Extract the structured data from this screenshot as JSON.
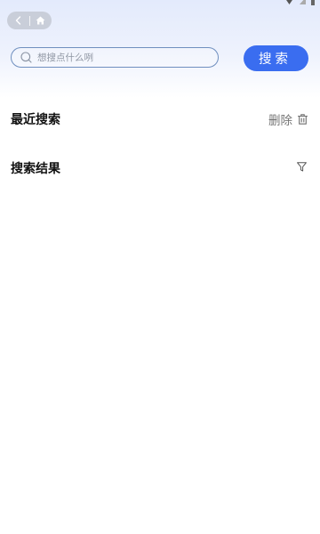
{
  "header": {
    "back_icon": "chevron-left-icon",
    "home_icon": "home-icon"
  },
  "search": {
    "placeholder": "想搜点什么咧",
    "value": "",
    "button_label": "搜索",
    "icon": "search-icon"
  },
  "recent": {
    "title": "最近搜索",
    "delete_label": "删除",
    "delete_icon": "trash-icon"
  },
  "results": {
    "title": "搜索结果",
    "filter_icon": "filter-icon"
  },
  "colors": {
    "accent": "#3a6df0",
    "header_gradient_top": "#e3eafc"
  }
}
